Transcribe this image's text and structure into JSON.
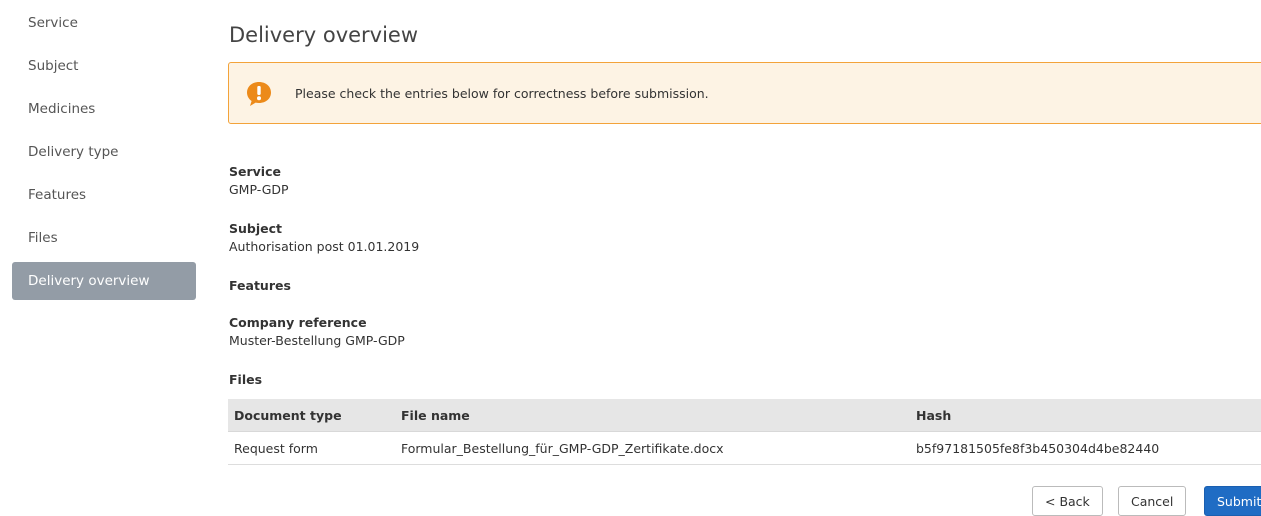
{
  "sidebar": {
    "items": [
      {
        "label": "Service"
      },
      {
        "label": "Subject"
      },
      {
        "label": "Medicines"
      },
      {
        "label": "Delivery type"
      },
      {
        "label": "Features"
      },
      {
        "label": "Files"
      },
      {
        "label": "Delivery overview",
        "active": true
      }
    ]
  },
  "main": {
    "title": "Delivery overview",
    "alert": {
      "icon": "exclamation-bubble-icon",
      "text": "Please check the entries below for correctness before submission.",
      "color": "#f3a33a"
    },
    "service": {
      "label": "Service",
      "value": "GMP-GDP"
    },
    "subject": {
      "label": "Subject",
      "value": "Authorisation post 01.01.2019"
    },
    "features": {
      "label": "Features"
    },
    "company_reference": {
      "label": "Company reference",
      "value": "Muster-Bestellung GMP-GDP"
    },
    "files": {
      "label": "Files",
      "columns": [
        "Document type",
        "File name",
        "Hash"
      ],
      "rows": [
        [
          "Request form",
          "Formular_Bestellung_für_GMP-GDP_Zertifikate.docx",
          "b5f97181505fe8f3b450304d4be82440"
        ]
      ]
    },
    "buttons": {
      "back": "< Back",
      "cancel": "Cancel",
      "submit": "Submit"
    }
  },
  "colors": {
    "active_nav": "#939ca6",
    "primary": "#1f6cc4",
    "alert_bg": "#fdf3e4"
  }
}
